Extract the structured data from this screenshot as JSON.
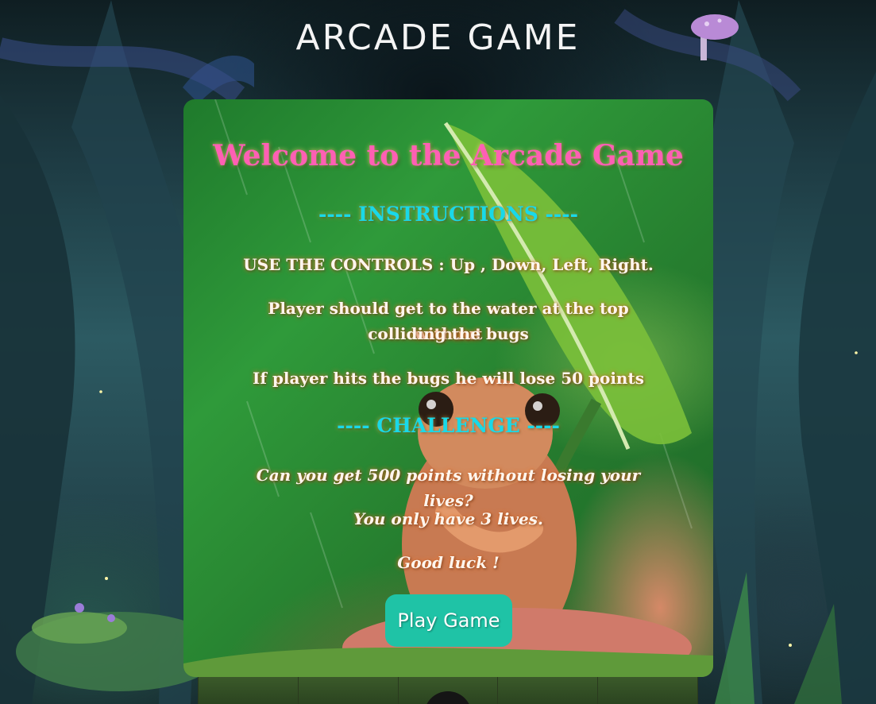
{
  "page": {
    "title": "ARCADE GAME"
  },
  "modal": {
    "welcome": "Welcome to the Arcade Game",
    "instructions_heading": "---- INSTRUCTIONS ----",
    "controls": "USE THE CONTROLS : Up , Down, Left, Right.",
    "goal_line1": "Player should get to the water at the top without",
    "goal_line2": "colliding the bugs",
    "penalty": "If player hits the bugs he will lose 50 points",
    "challenge_heading": "---- CHALLENGE ----",
    "challenge_question": "Can you get 500 points without losing your lives?",
    "lives": "You only have 3 lives.",
    "good_luck": "Good luck !",
    "play_button": "Play Game"
  },
  "colors": {
    "welcome": "#ff5fb4",
    "heading": "#19d9e8",
    "button": "#1fc3a6"
  },
  "icons": [
    "mushroom-icon",
    "frog-image",
    "bug-icon"
  ]
}
